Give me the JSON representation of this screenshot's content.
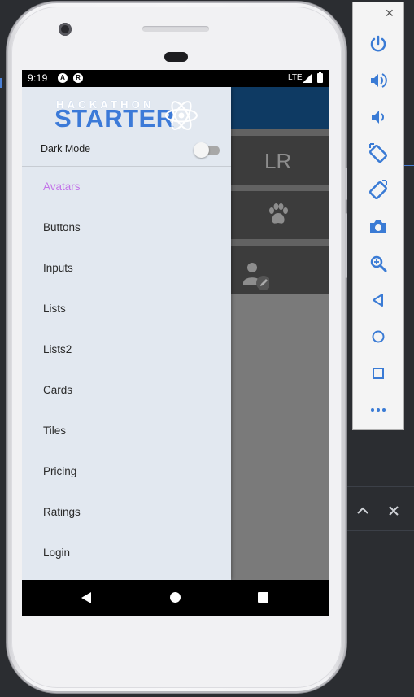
{
  "status_bar": {
    "time": "9:19",
    "notif_icon_1": "A",
    "notif_icon_2": "R",
    "network": "LTE"
  },
  "drawer": {
    "logo": {
      "small_text": "HACKATHON",
      "big_text": "STARTER"
    },
    "dark_mode_label": "Dark Mode",
    "dark_mode_on": false,
    "menu_items": [
      {
        "label": "Avatars",
        "active": true
      },
      {
        "label": "Buttons",
        "active": false
      },
      {
        "label": "Inputs",
        "active": false
      },
      {
        "label": "Lists",
        "active": false
      },
      {
        "label": "Lists2",
        "active": false
      },
      {
        "label": "Cards",
        "active": false
      },
      {
        "label": "Tiles",
        "active": false
      },
      {
        "label": "Pricing",
        "active": false
      },
      {
        "label": "Ratings",
        "active": false
      },
      {
        "label": "Login",
        "active": false
      }
    ]
  },
  "background_app": {
    "avatar_initials": "LR",
    "icons": [
      "paw-icon",
      "person-edit-icon"
    ]
  },
  "emulator_toolbar": {
    "minimize_label": "–",
    "close_label": "✕",
    "buttons": [
      "power-icon",
      "volume-up-icon",
      "volume-down-icon",
      "rotate-left-icon",
      "rotate-right-icon",
      "camera-icon",
      "zoom-icon",
      "back-icon",
      "home-icon",
      "overview-icon",
      "more-icon"
    ]
  },
  "colors": {
    "accent_active": "#c374e9",
    "logo_blue": "#3c7ad8",
    "drawer_bg": "#e2e8f0",
    "app_header": "#0e3a63"
  }
}
